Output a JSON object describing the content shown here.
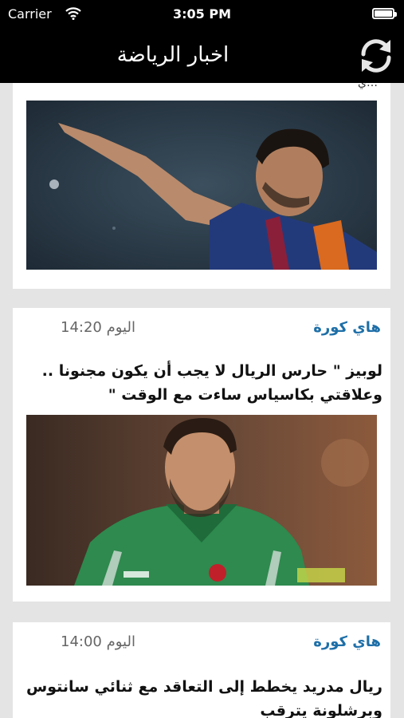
{
  "status_bar": {
    "carrier": "Carrier",
    "time": "3:05 PM"
  },
  "nav": {
    "title": "اخبار الرياضة",
    "refresh_icon": "refresh-icon"
  },
  "cards": [
    {
      "partial_text": "…ي",
      "image_subject": "football-player-pointing"
    },
    {
      "source": "هاي كورة",
      "stamp": "اليوم 14:20",
      "headline": "لوبيز \" حارس الريال لا يجب أن يكون مجنونا .. وعلاقتي بكاسياس ساءت مع الوقت \"",
      "image_subject": "goalkeeper-portrait"
    },
    {
      "source": "هاي كورة",
      "stamp": "اليوم 14:00",
      "headline": "ريال مدريد يخطط إلى التعاقد مع ثنائي سانتوس وبرشلونة يترقب"
    }
  ],
  "colors": {
    "bar_background": "#000000",
    "source_link": "#1e6fa8",
    "page_background": "#e4e4e4"
  }
}
